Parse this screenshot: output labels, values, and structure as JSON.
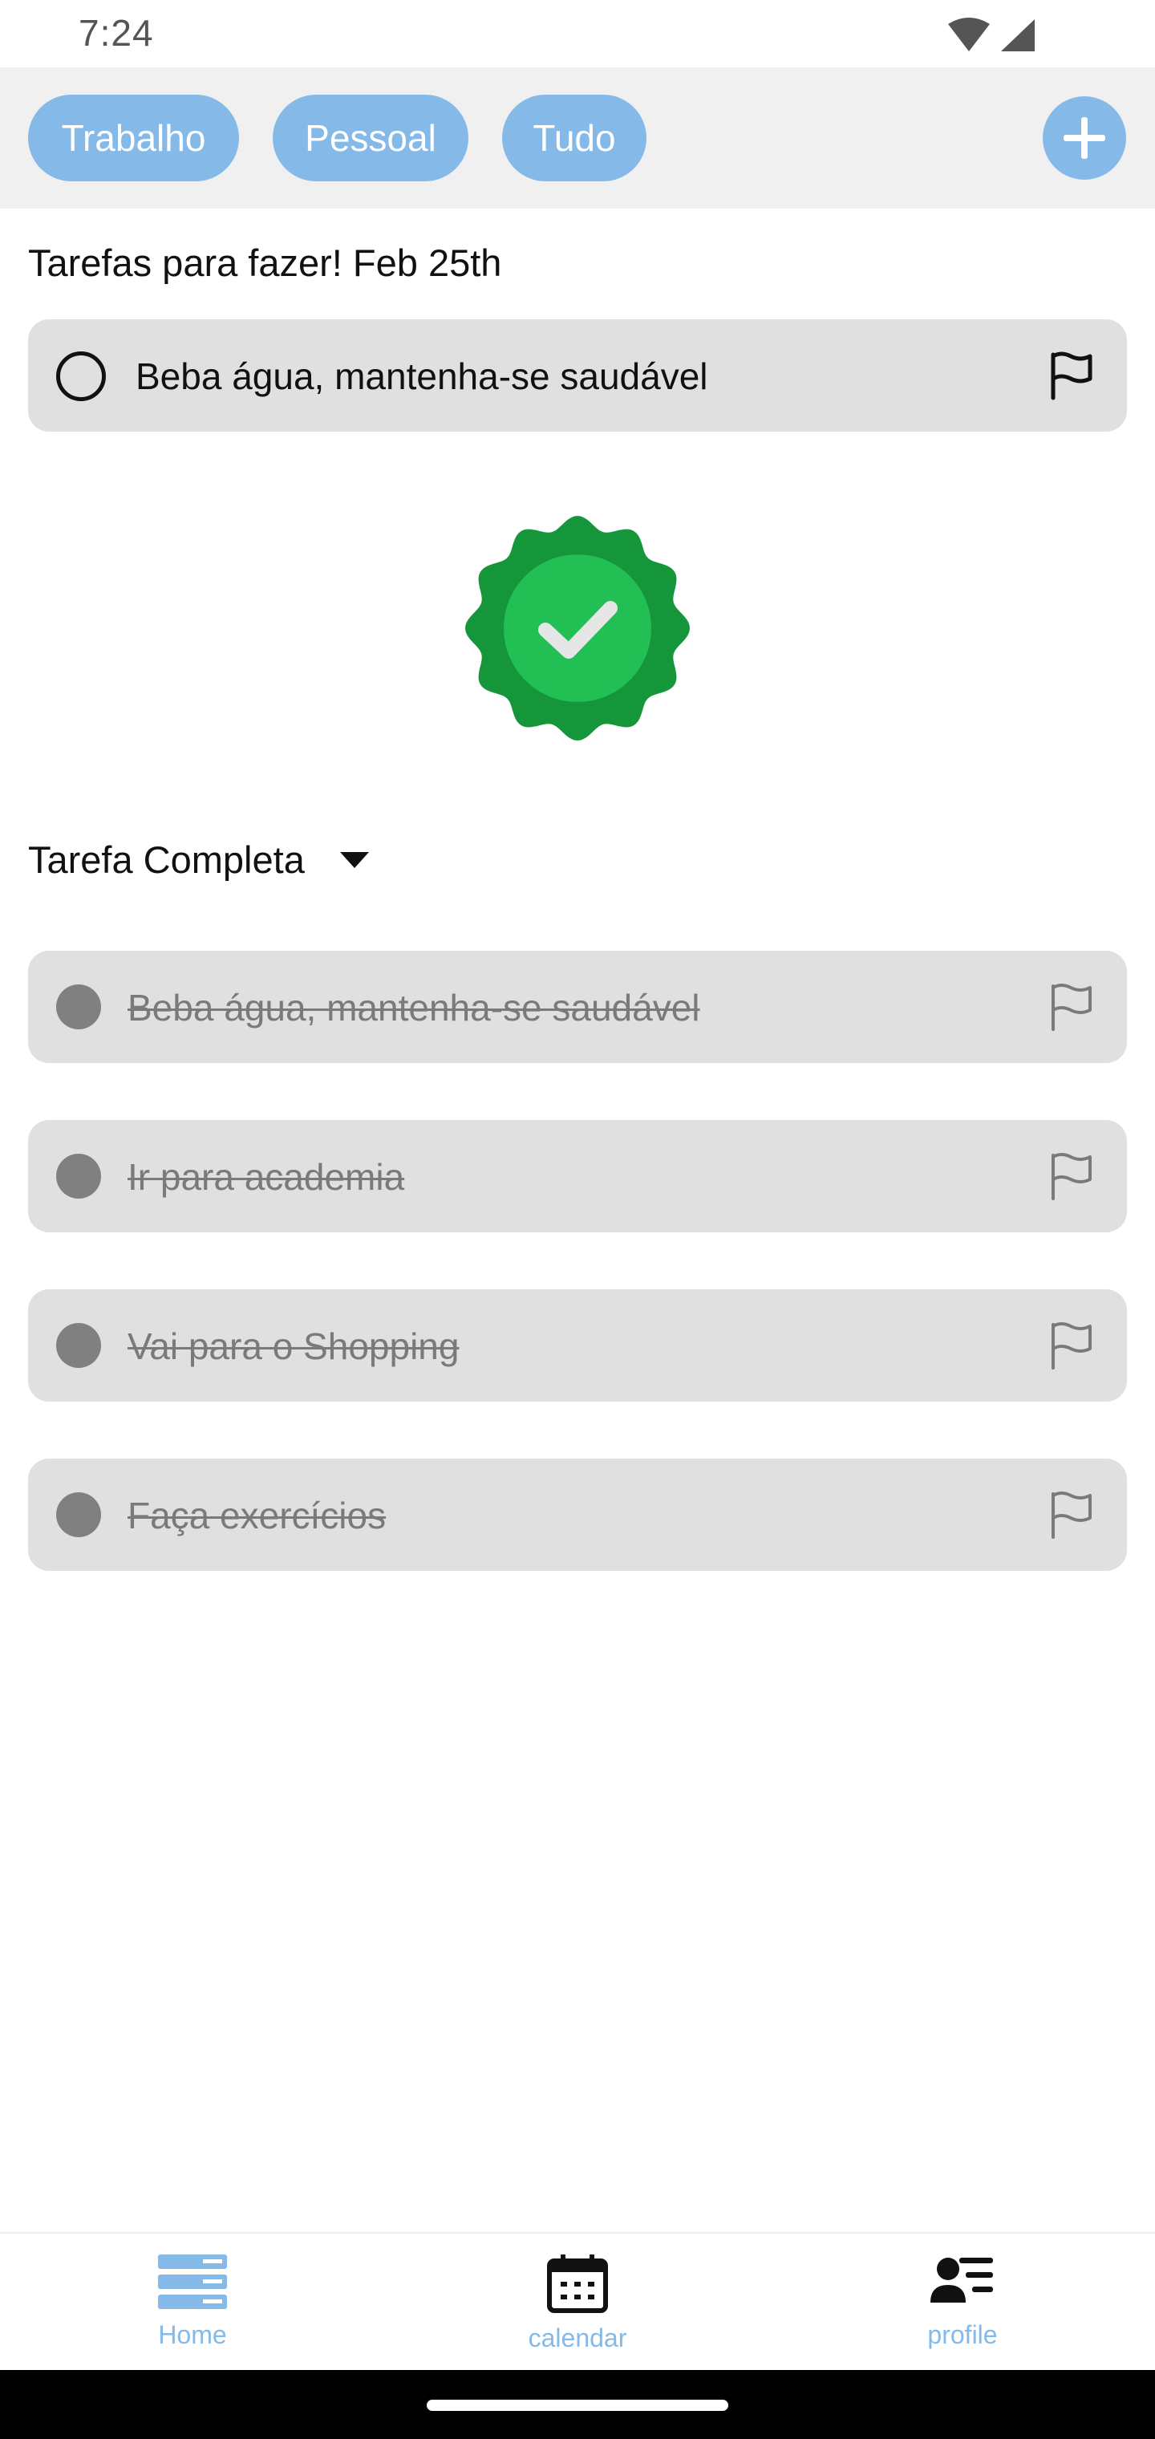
{
  "status_bar": {
    "time": "7:24",
    "icons": [
      "wifi-icon",
      "signal-icon"
    ]
  },
  "filters": {
    "chips": [
      "Trabalho",
      "Pessoal",
      "Tudo"
    ],
    "add_icon": "plus-icon",
    "accent": "#84b9e8"
  },
  "section_title": "Tarefas para fazer! Feb 25th",
  "pending_tasks": [
    {
      "label": "Beba água, mantenha-se saudável",
      "icon": "flag-icon"
    }
  ],
  "success_badge": {
    "icon": "check-badge-icon",
    "colors": [
      "#15963a",
      "#22bf55"
    ]
  },
  "completed": {
    "title": "Tarefa Completa",
    "toggle_icon": "caret-down-icon",
    "tasks": [
      {
        "label": "Beba água, mantenha-se saudável"
      },
      {
        "label": "Ir para academia"
      },
      {
        "label": "Vai para o Shopping"
      },
      {
        "label": "Faça exercícios"
      }
    ]
  },
  "bottom_nav": {
    "items": [
      {
        "label": "Home",
        "icon": "home-stack-icon"
      },
      {
        "label": "calendar",
        "icon": "calendar-icon"
      },
      {
        "label": "profile",
        "icon": "profile-list-icon"
      }
    ]
  }
}
